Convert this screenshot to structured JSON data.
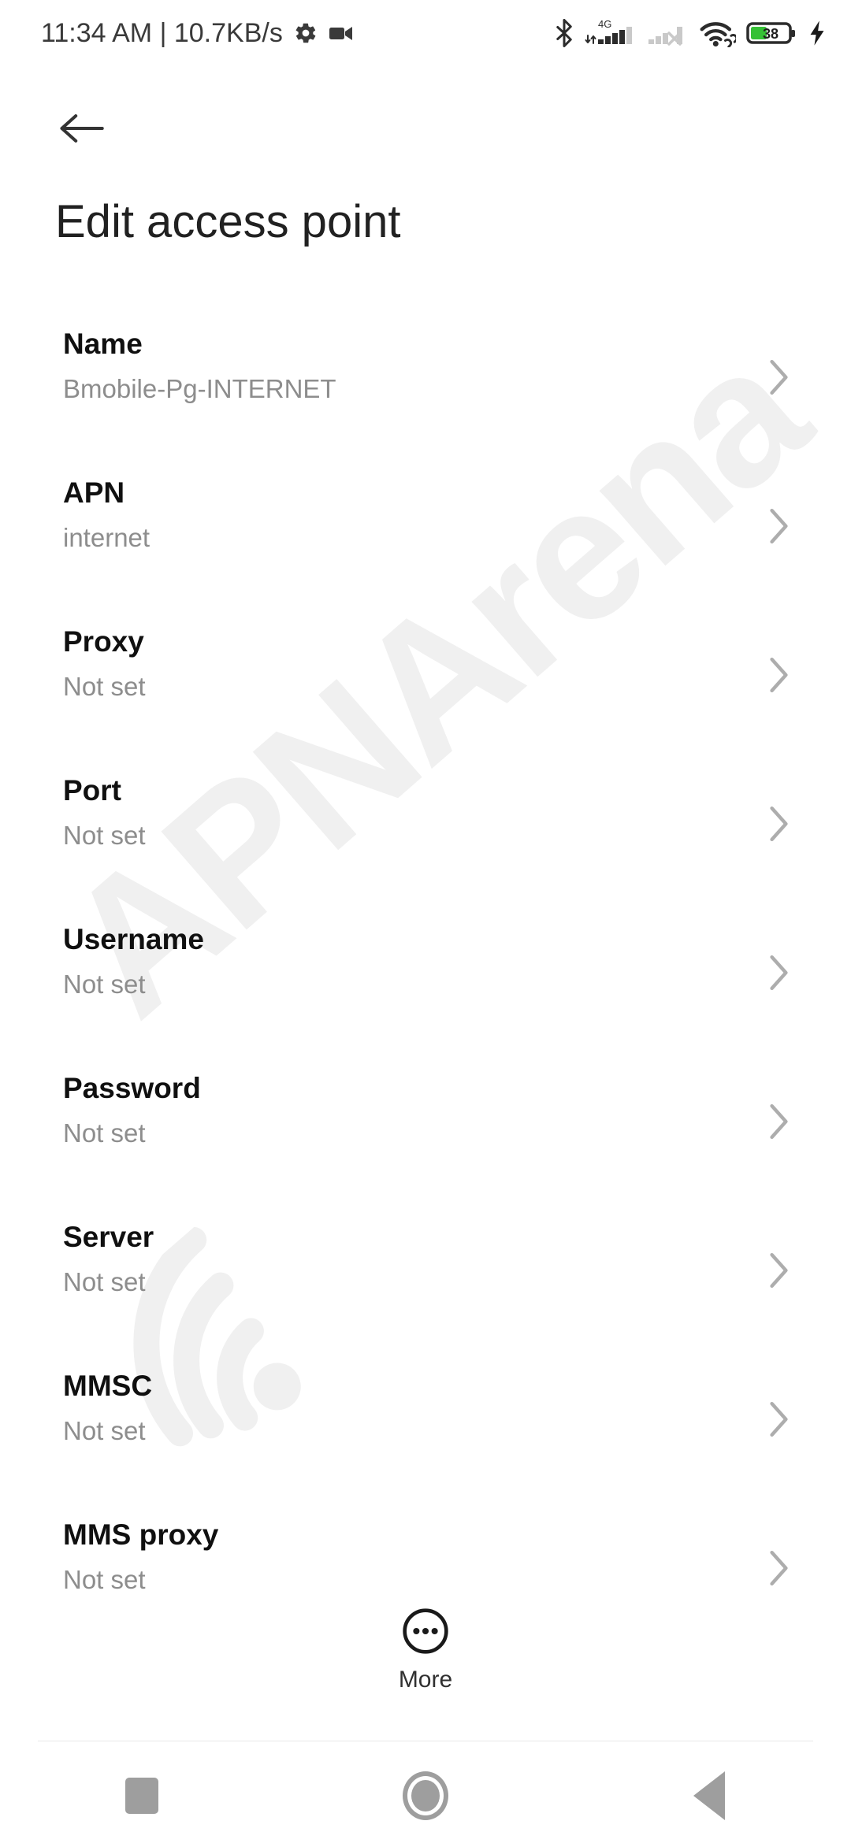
{
  "status_bar": {
    "clock_and_speed": "11:34 AM | 10.7KB/s",
    "left_icons": [
      "gear-icon",
      "video-camera-icon"
    ],
    "right_icons": [
      "bluetooth-icon",
      "mobile-signal-4g-icon",
      "mobile-signal-no-service-icon",
      "wifi-icon",
      "battery-icon",
      "charging-bolt-icon"
    ],
    "network_type": "4G",
    "battery_percent": "38",
    "battery_color": "#35c135",
    "charging": true
  },
  "header": {
    "back_label": "Back",
    "title": "Edit access point"
  },
  "list": {
    "items": [
      {
        "title": "Name",
        "value": "Bmobile-Pg-INTERNET"
      },
      {
        "title": "APN",
        "value": "internet"
      },
      {
        "title": "Proxy",
        "value": "Not set"
      },
      {
        "title": "Port",
        "value": "Not set"
      },
      {
        "title": "Username",
        "value": "Not set"
      },
      {
        "title": "Password",
        "value": "Not set"
      },
      {
        "title": "Server",
        "value": "Not set"
      },
      {
        "title": "MMSC",
        "value": "Not set"
      },
      {
        "title": "MMS proxy",
        "value": "Not set"
      }
    ]
  },
  "more_button": {
    "label": "More"
  },
  "nav_bar": {
    "recents_label": "Recents",
    "home_label": "Home",
    "back_label": "Back"
  },
  "watermark": {
    "text": "APNArena"
  }
}
